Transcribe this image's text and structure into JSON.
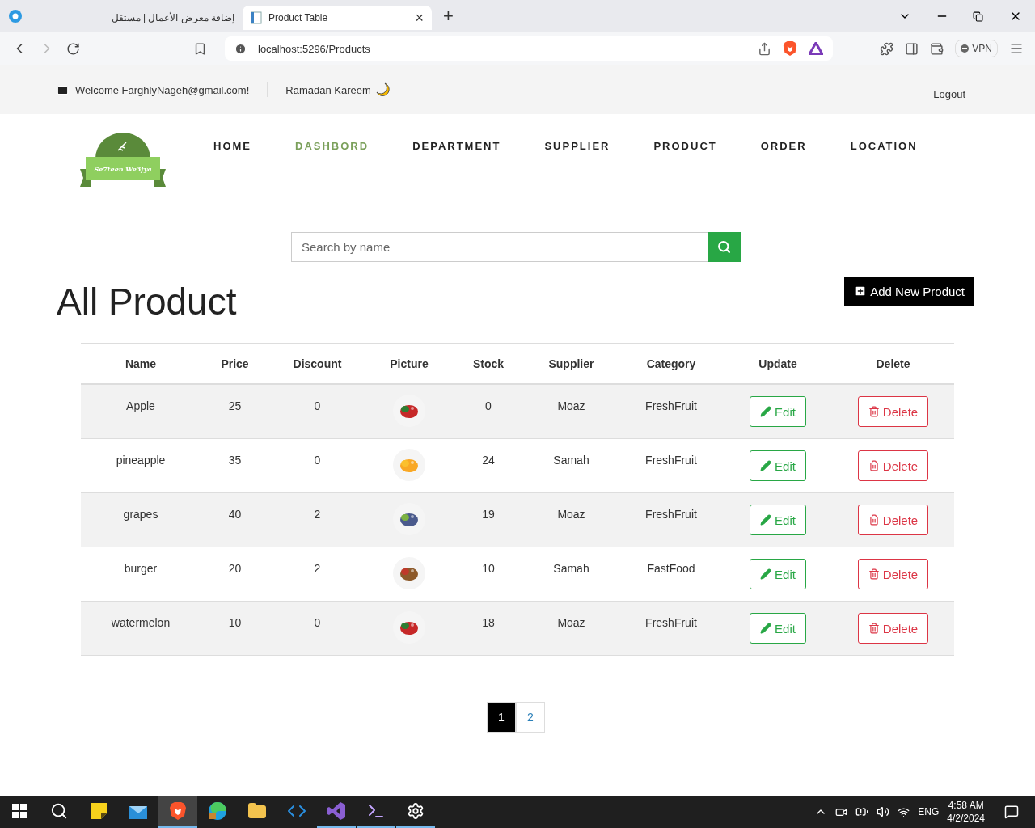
{
  "browser": {
    "tabs": [
      {
        "title": "إضافة معرض الأعمال | مستقل",
        "selected": false
      },
      {
        "title": "Product Table",
        "selected": true
      }
    ],
    "close_tab": "×",
    "new_tab": "+",
    "address": "localhost:5296/Products",
    "vpn": "VPN"
  },
  "topbar": {
    "welcome": "Welcome FarghlyNageh@gmail.com!",
    "greeting": "Ramadan Kareem",
    "logout": "Logout"
  },
  "logo": {
    "text": "Se7teen We3fya"
  },
  "nav": [
    {
      "label": "HOME",
      "selected": false
    },
    {
      "label": "DASHBORD",
      "selected": true
    },
    {
      "label": "DEPARTMENT",
      "selected": false
    },
    {
      "label": "SUPPLIER",
      "selected": false
    },
    {
      "label": "PRODUCT",
      "selected": false
    },
    {
      "label": "ORDER",
      "selected": false
    },
    {
      "label": "LOCATION",
      "selected": false
    }
  ],
  "search": {
    "placeholder": "Search by name"
  },
  "title": "All Product",
  "add_button": "Add New Product",
  "table": {
    "columns": [
      "Name",
      "Price",
      "Discount",
      "Picture",
      "Stock",
      "Supplier",
      "Category",
      "Update",
      "Delete"
    ],
    "rows": [
      {
        "name": "Apple",
        "price": "25",
        "discount": "0",
        "stock": "0",
        "supplier": "Moaz",
        "category": "FreshFruit",
        "edit": "Edit",
        "delete": "Delete"
      },
      {
        "name": "pineapple",
        "price": "35",
        "discount": "0",
        "stock": "24",
        "supplier": "Samah",
        "category": "FreshFruit",
        "edit": "Edit",
        "delete": "Delete"
      },
      {
        "name": "grapes",
        "price": "40",
        "discount": "2",
        "stock": "19",
        "supplier": "Moaz",
        "category": "FreshFruit",
        "edit": "Edit",
        "delete": "Delete"
      },
      {
        "name": "burger",
        "price": "20",
        "discount": "2",
        "stock": "10",
        "supplier": "Samah",
        "category": "FastFood",
        "edit": "Edit",
        "delete": "Delete"
      },
      {
        "name": "watermelon",
        "price": "10",
        "discount": "0",
        "stock": "18",
        "supplier": "Moaz",
        "category": "FreshFruit",
        "edit": "Edit",
        "delete": "Delete"
      }
    ]
  },
  "pagination": [
    {
      "label": "1",
      "selected": true
    },
    {
      "label": "2",
      "selected": false
    }
  ],
  "taskbar": {
    "apps": [
      {
        "kind": "search",
        "selected": false,
        "running": false
      },
      {
        "kind": "notes",
        "selected": false,
        "running": false
      },
      {
        "kind": "mail",
        "selected": false,
        "running": false
      },
      {
        "kind": "brave",
        "selected": true,
        "running": true
      },
      {
        "kind": "edge",
        "selected": false,
        "running": false
      },
      {
        "kind": "folder",
        "selected": false,
        "running": false
      },
      {
        "kind": "vscode",
        "selected": false,
        "running": false
      },
      {
        "kind": "studio",
        "selected": false,
        "running": true
      },
      {
        "kind": "terminal",
        "selected": false,
        "running": true
      },
      {
        "kind": "settings",
        "selected": false,
        "running": true
      }
    ],
    "language": "ENG",
    "time": "4:58 AM",
    "date": "4/2/2024"
  }
}
